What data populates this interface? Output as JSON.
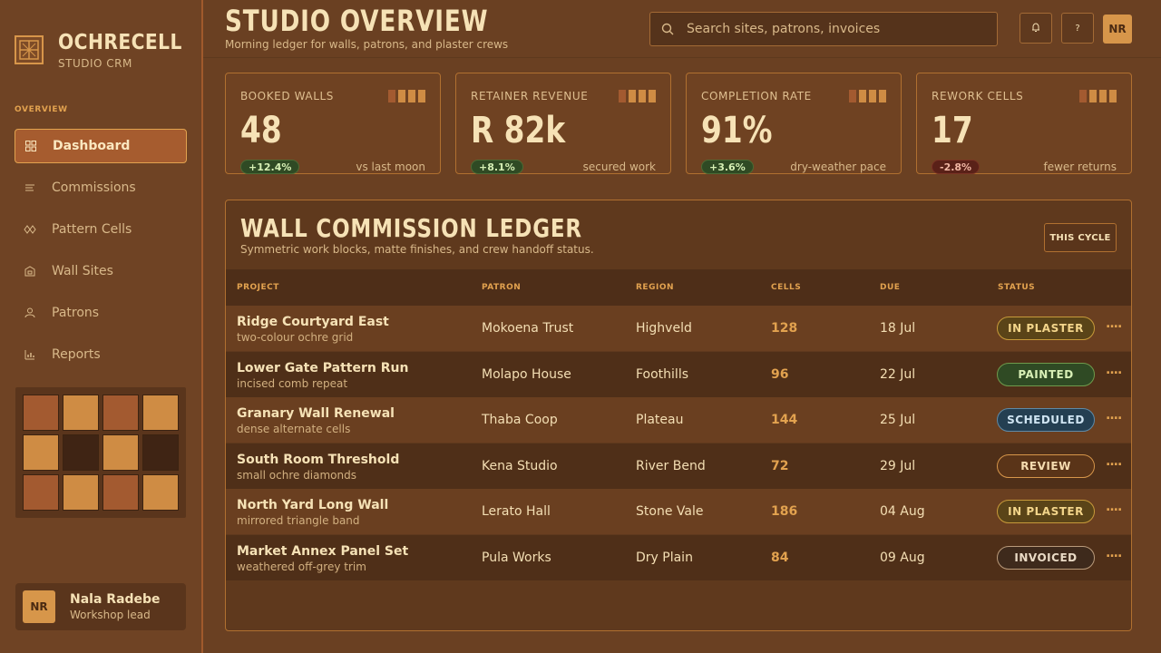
{
  "brand": {
    "name": "OCHRECELL",
    "subtitle": "STUDIO CRM"
  },
  "nav": {
    "section": "OVERVIEW",
    "items": [
      {
        "label": "Dashboard",
        "icon": "grid-icon",
        "active": true
      },
      {
        "label": "Commissions",
        "icon": "list-icon"
      },
      {
        "label": "Pattern Cells",
        "icon": "diamond-pattern-icon"
      },
      {
        "label": "Wall Sites",
        "icon": "building-icon"
      },
      {
        "label": "Patrons",
        "icon": "person-icon"
      },
      {
        "label": "Reports",
        "icon": "bar-chart-icon"
      }
    ]
  },
  "pattern_colors": [
    "#a35a30",
    "#cf8c44",
    "#a35a30",
    "#cf8c44",
    "#cf8c44",
    "#3f2414",
    "#cf8c44",
    "#3f2414",
    "#a35a30",
    "#cf8c44",
    "#a35a30",
    "#cf8c44"
  ],
  "user": {
    "initials": "NR",
    "name": "Nala Radebe",
    "role": "Workshop lead"
  },
  "header": {
    "title": "STUDIO OVERVIEW",
    "subtitle": "Morning ledger for walls, patrons, and plaster crews",
    "search_placeholder": "Search sites, patrons, invoices",
    "help_label": "?",
    "initials": "NR"
  },
  "kpis": [
    {
      "label": "BOOKED WALLS",
      "value": "48",
      "delta": "+12.4%",
      "trend": "up",
      "note": "vs last moon"
    },
    {
      "label": "RETAINER REVENUE",
      "value": "R 82k",
      "delta": "+8.1%",
      "trend": "up",
      "note": "secured work"
    },
    {
      "label": "COMPLETION RATE",
      "value": "91%",
      "delta": "+3.6%",
      "trend": "up",
      "note": "dry-weather pace"
    },
    {
      "label": "REWORK CELLS",
      "value": "17",
      "delta": "-2.8%",
      "trend": "down",
      "note": "fewer returns"
    }
  ],
  "ledger": {
    "title": "WALL COMMISSION LEDGER",
    "subtitle": "Symmetric work blocks, matte finishes, and crew handoff status.",
    "cycle_label": "THIS CYCLE",
    "columns": [
      "PROJECT",
      "PATRON",
      "REGION",
      "CELLS",
      "DUE",
      "STATUS"
    ],
    "rows": [
      {
        "project": "Ridge Courtyard East",
        "detail": "two-colour ochre grid",
        "patron": "Mokoena Trust",
        "region": "Highveld",
        "cells": "128",
        "due": "18 Jul",
        "status": "IN PLASTER"
      },
      {
        "project": "Lower Gate Pattern Run",
        "detail": "incised comb repeat",
        "patron": "Molapo House",
        "region": "Foothills",
        "cells": "96",
        "due": "22 Jul",
        "status": "PAINTED"
      },
      {
        "project": "Granary Wall Renewal",
        "detail": "dense alternate cells",
        "patron": "Thaba Coop",
        "region": "Plateau",
        "cells": "144",
        "due": "25 Jul",
        "status": "SCHEDULED"
      },
      {
        "project": "South Room Threshold",
        "detail": "small ochre diamonds",
        "patron": "Kena Studio",
        "region": "River Bend",
        "cells": "72",
        "due": "29 Jul",
        "status": "REVIEW"
      },
      {
        "project": "North Yard Long Wall",
        "detail": "mirrored triangle band",
        "patron": "Lerato Hall",
        "region": "Stone Vale",
        "cells": "186",
        "due": "04 Aug",
        "status": "IN PLASTER"
      },
      {
        "project": "Market Annex Panel Set",
        "detail": "weathered off-grey trim",
        "patron": "Pula Works",
        "region": "Dry Plain",
        "cells": "84",
        "due": "09 Aug",
        "status": "INVOICED"
      }
    ]
  },
  "status_colors": {
    "IN PLASTER": {
      "bg": "#5a4418",
      "border": "#c79a3a",
      "text": "#f3d58a"
    },
    "PAINTED": {
      "bg": "#2f4a24",
      "border": "#6f9a4c",
      "text": "#d8efb6"
    },
    "SCHEDULED": {
      "bg": "#243f52",
      "border": "#5f8aa6",
      "text": "#cfe4f2"
    },
    "REVIEW": {
      "bg": "#5a3418",
      "border": "#d7964a",
      "text": "#f6dcb0"
    },
    "INVOICED": {
      "bg": "#3e2a1c",
      "border": "#b99a7a",
      "text": "#eadbc6"
    }
  }
}
